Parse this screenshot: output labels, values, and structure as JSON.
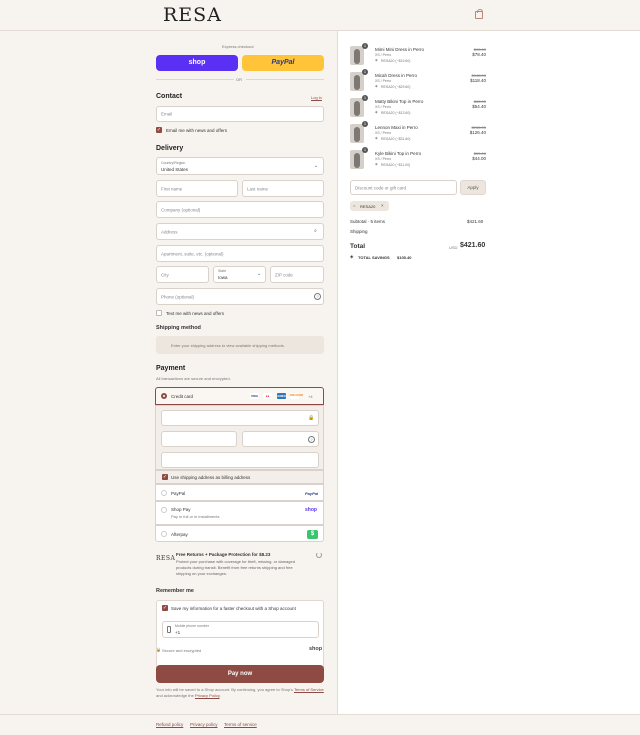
{
  "header": {
    "logo": "RESA"
  },
  "express": {
    "label": "Express checkout",
    "shop_label": "shop",
    "paypal_label": "PayPal",
    "or_label": "OR"
  },
  "contact": {
    "title": "Contact",
    "login": "Log in",
    "email_placeholder": "Email",
    "news_label": "Email me with news and offers"
  },
  "delivery": {
    "title": "Delivery",
    "country_label": "Country/Region",
    "country_value": "United States",
    "first_name": "First name",
    "last_name": "Last name",
    "company": "Company (optional)",
    "address": "Address",
    "apartment": "Apartment, suite, etc. (optional)",
    "city": "City",
    "state_label": "State",
    "state_value": "Iowa",
    "zip": "ZIP code",
    "phone": "Phone (optional)",
    "text_label": "Text me with news and offers"
  },
  "shipping": {
    "title": "Shipping method",
    "notice": "Enter your shipping address to view available shipping methods."
  },
  "payment": {
    "title": "Payment",
    "subtitle": "All transactions are secure and encrypted.",
    "credit_label": "Credit card",
    "more_cards": "+4",
    "billing_label": "Use shipping address as billing address",
    "paypal_label": "PayPal",
    "paypal_logo": "PayPal",
    "shoppay_label": "Shop Pay",
    "shoppay_sub": "Pay in full or in installments",
    "shoppay_logo": "shop",
    "afterpay_label": "Afterpay",
    "card_logos": [
      "VISA",
      "MC",
      "AMEX",
      "DISCOVER"
    ],
    "colors": {
      "accent": "#8e4b43",
      "shop": "#5a31f4",
      "paypal": "#ffc439"
    }
  },
  "protection": {
    "logo": "RESA",
    "title": "Free Returns + Package Protection for $8.23",
    "desc": "Protect your purchase with coverage for theft, missing, or damaged products during transit. Benefit from free returns shipping and free shipping on your exchanges."
  },
  "remember": {
    "title": "Remember me",
    "save_label": "Save my information for a faster checkout with a Shop account",
    "phone_label": "Mobile phone number",
    "phone_value": "+1"
  },
  "secure": {
    "label": "Secure and encrypted",
    "shop_logo": "shop"
  },
  "pay_button": "Pay now",
  "disclaimer": {
    "pre": "Your info will be saved to a Shop account. By continuing, you agree to Shop's",
    "terms": "Terms of Service",
    "mid": "and acknowledge the",
    "privacy": "Privacy Policy",
    "end": "."
  },
  "footer": {
    "links": [
      "Refund policy",
      "Privacy policy",
      "Terms of service"
    ]
  },
  "cart": {
    "items": [
      {
        "qty": "1",
        "name": "Mimi Mini Dress in Perro",
        "variant": "XS / Perro",
        "discount": "RESA20 (−$19.60)",
        "old": "$98.00",
        "price": "$78.40"
      },
      {
        "qty": "1",
        "name": "Micah Dress in Perro",
        "variant": "XS / Perro",
        "discount": "RESA20 (−$29.60)",
        "old": "$148.00",
        "price": "$118.40"
      },
      {
        "qty": "1",
        "name": "Matty Bikini Top in Perro",
        "variant": "XS / Perro",
        "discount": "RESA20 (−$13.60)",
        "old": "$68.00",
        "price": "$54.40"
      },
      {
        "qty": "1",
        "name": "Lennon Maxi in Perro",
        "variant": "XS / Perro",
        "discount": "RESA20 (−$31.60)",
        "old": "$158.00",
        "price": "$126.40"
      },
      {
        "qty": "1",
        "name": "Kyle Bikini Top in Perro",
        "variant": "XS / Perro",
        "discount": "RESA20 (−$11.00)",
        "old": "$55.00",
        "price": "$44.00"
      }
    ],
    "discount_placeholder": "Discount code or gift card",
    "apply": "Apply",
    "code_tag": "RESA20",
    "subtotal_label": "Subtotal · 5 items",
    "subtotal_value": "$421.60",
    "shipping_label": "Shipping",
    "total_label": "Total",
    "currency": "USD",
    "total_value": "$421.60",
    "savings_label": "TOTAL SAVINGS",
    "savings_value": "$105.40"
  }
}
